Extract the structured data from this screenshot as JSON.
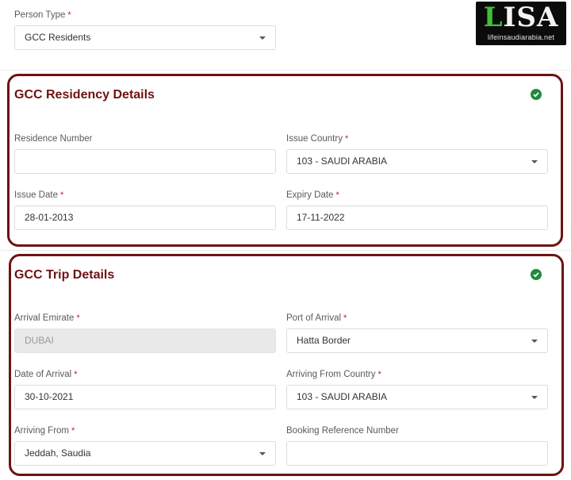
{
  "logo": {
    "letter_accent": "L",
    "letters": "ISA",
    "subtitle": "lifeinsaudiarabia.net"
  },
  "required_marker": "*",
  "person_type": {
    "label": "Person Type",
    "required": true,
    "value": "GCC Residents"
  },
  "residency_section": {
    "title": "GCC Residency Details",
    "status_icon": "check-circle-icon",
    "fields": {
      "residence_number": {
        "label": "Residence Number",
        "value": ""
      },
      "issue_country": {
        "label": "Issue Country",
        "required": true,
        "value": "103 - SAUDI ARABIA"
      },
      "issue_date": {
        "label": "Issue Date",
        "required": true,
        "value": "28-01-2013"
      },
      "expiry_date": {
        "label": "Expiry Date",
        "required": true,
        "value": "17-11-2022"
      }
    }
  },
  "trip_section": {
    "title": "GCC Trip Details",
    "status_icon": "check-circle-icon",
    "fields": {
      "arrival_emirate": {
        "label": "Arrival Emirate",
        "required": true,
        "value": "DUBAI",
        "disabled": true
      },
      "port_of_arrival": {
        "label": "Port of Arrival",
        "required": true,
        "value": "Hatta Border"
      },
      "date_of_arrival": {
        "label": "Date of Arrival",
        "required": true,
        "value": "30-10-2021"
      },
      "arriving_from_country": {
        "label": "Arriving From Country",
        "required": true,
        "value": "103 - SAUDI ARABIA"
      },
      "arriving_from": {
        "label": "Arriving From",
        "required": true,
        "value": "Jeddah, Saudia"
      },
      "booking_reference": {
        "label": "Booking Reference Number",
        "value": ""
      }
    }
  },
  "colors": {
    "section_border": "#6e1212",
    "section_title": "#6e1212",
    "required": "#b22222",
    "check": "#1f8b3a",
    "logo_accent": "#3fc03a"
  }
}
